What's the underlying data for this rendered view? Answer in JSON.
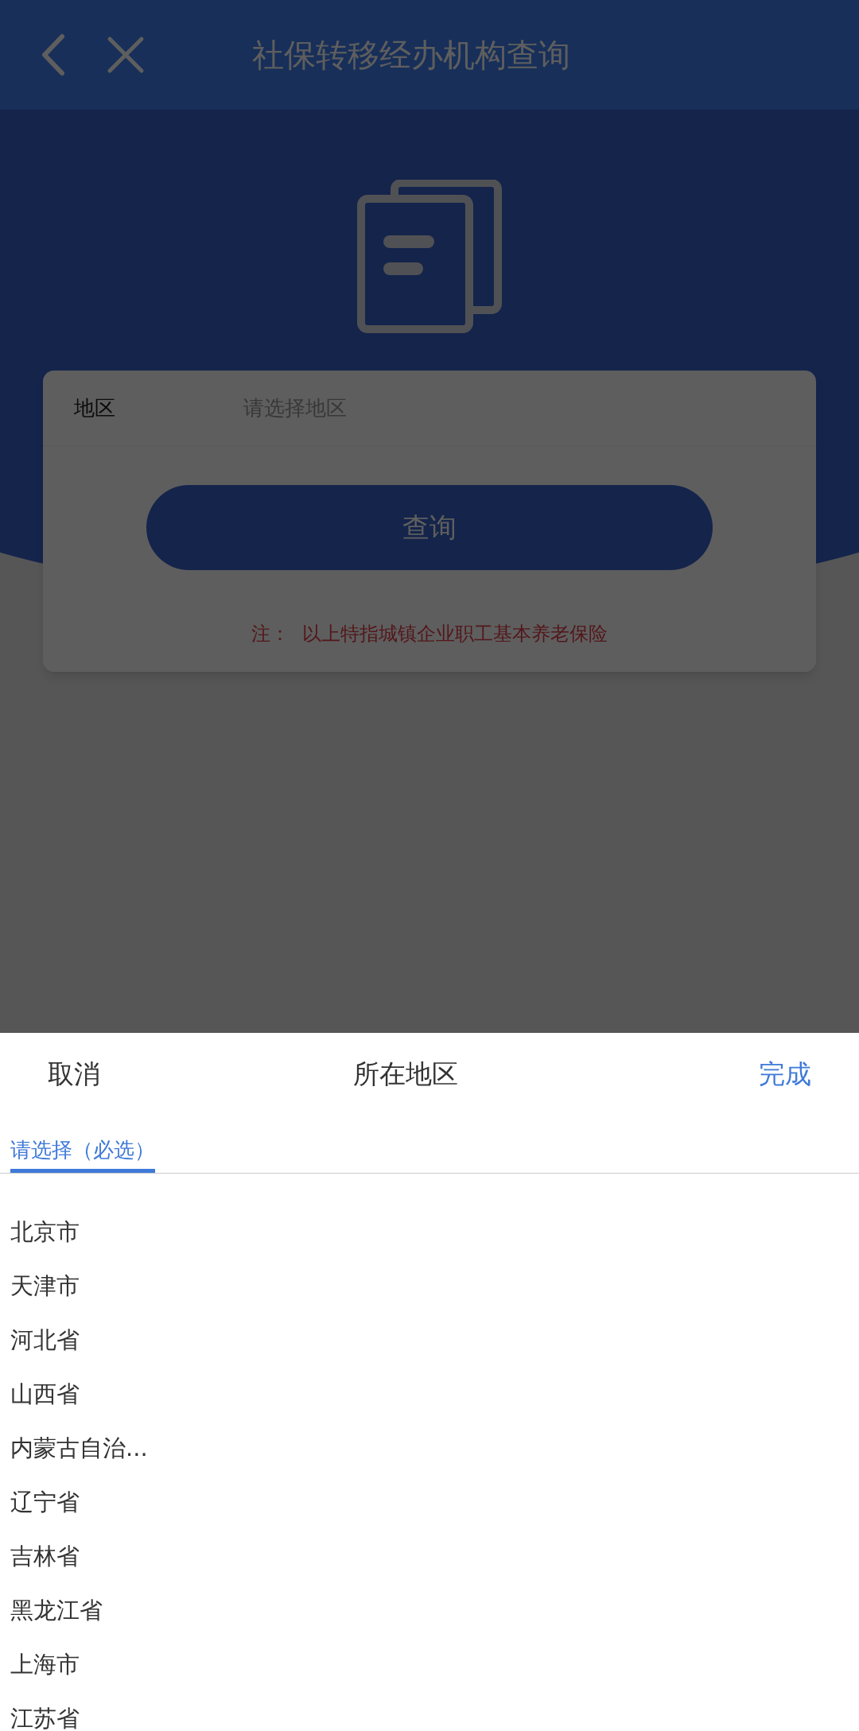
{
  "header": {
    "title": "社保转移经办机构查询"
  },
  "form": {
    "label": "地区",
    "placeholder": "请选择地区",
    "button": "查询",
    "note": "注：  以上特指城镇企业职工基本养老保险"
  },
  "sheet": {
    "cancel": "取消",
    "title": "所在地区",
    "done": "完成",
    "tabs": [
      {
        "label": "请选择（必选）",
        "selected": true
      }
    ],
    "items": [
      "北京市",
      "天津市",
      "河北省",
      "山西省",
      "内蒙古自治...",
      "辽宁省",
      "吉林省",
      "黑龙江省",
      "上海市",
      "江苏省"
    ]
  }
}
